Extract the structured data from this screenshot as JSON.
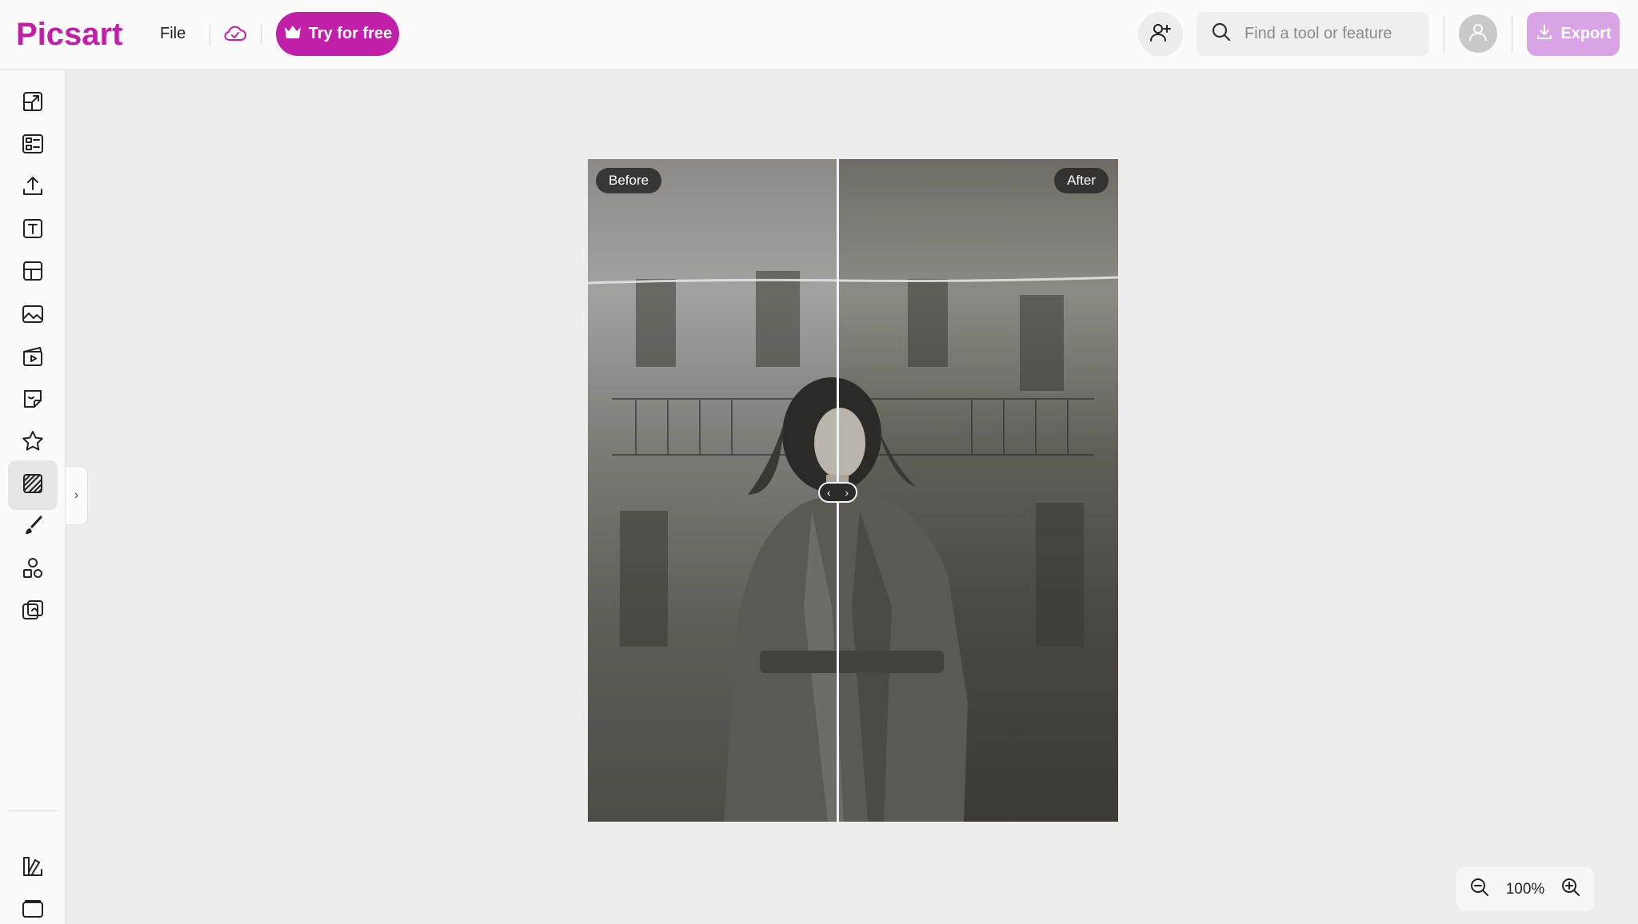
{
  "header": {
    "logo_text": "Picsart",
    "file_label": "File",
    "try_label": "Try for free",
    "search_placeholder": "Find a tool or feature",
    "export_label": "Export"
  },
  "sidebar": {
    "items": [
      {
        "name": "resize-icon"
      },
      {
        "name": "templates-icon"
      },
      {
        "name": "upload-icon"
      },
      {
        "name": "text-icon"
      },
      {
        "name": "layout-icon"
      },
      {
        "name": "photos-icon"
      },
      {
        "name": "video-icon"
      },
      {
        "name": "stickers-icon"
      },
      {
        "name": "favorites-icon"
      },
      {
        "name": "background-icon",
        "active": true
      },
      {
        "name": "brush-icon"
      },
      {
        "name": "elements-icon"
      },
      {
        "name": "ai-tools-icon"
      },
      {
        "name": "brand-kit-icon"
      },
      {
        "name": "folders-icon"
      }
    ],
    "collapse_symbol": "›"
  },
  "canvas": {
    "before_label": "Before",
    "after_label": "After",
    "divider_fraction": 0.47
  },
  "zoom": {
    "value": "100%"
  },
  "colors": {
    "brand": "#c21fa9",
    "export_disabled": "#d9a4e6"
  }
}
